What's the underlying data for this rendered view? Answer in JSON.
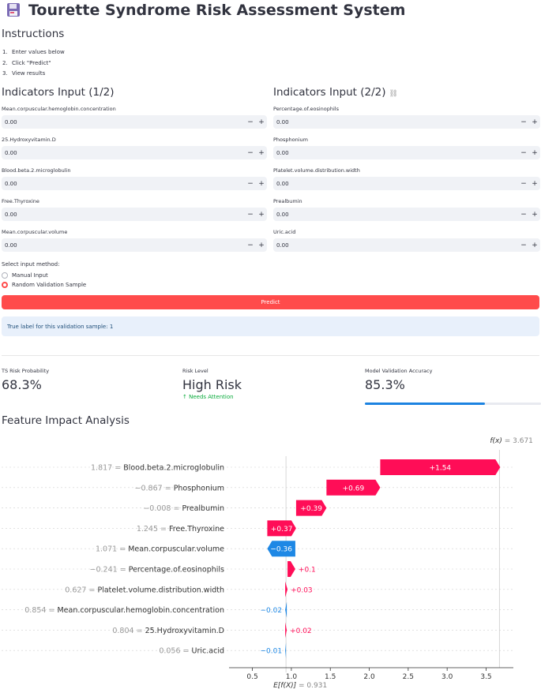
{
  "app": {
    "title": "Tourette Syndrome Risk Assessment System",
    "icon": "floppy-disk-icon"
  },
  "instructions": {
    "heading": "Instructions",
    "steps": [
      {
        "n": "1.",
        "text": "Enter values below"
      },
      {
        "n": "2.",
        "text": "Click \"Predict\""
      },
      {
        "n": "3.",
        "text": "View results"
      }
    ]
  },
  "panel1": {
    "heading": "Indicators Input (1/2)",
    "fields": [
      {
        "label": "Mean.corpuscular.hemoglobin.concentration",
        "value": "0.00"
      },
      {
        "label": "25.Hydroxyvitamin.D",
        "value": "0.00"
      },
      {
        "label": "Blood.beta.2.microglobulin",
        "value": "0.00"
      },
      {
        "label": "Free.Thyroxine",
        "value": "0.00"
      },
      {
        "label": "Mean.corpuscular.volume",
        "value": "0.00"
      }
    ]
  },
  "panel2": {
    "heading": "Indicators Input (2/2)",
    "fields": [
      {
        "label": "Percentage.of.eosinophils",
        "value": "0.00"
      },
      {
        "label": "Phosphonium",
        "value": "0.00"
      },
      {
        "label": "Platelet.volume.distribution.width",
        "value": "0.00"
      },
      {
        "label": "Prealbumin",
        "value": "0.00"
      },
      {
        "label": "Uric.acid",
        "value": "0.00"
      }
    ]
  },
  "stepper": {
    "minus": "−",
    "plus": "+"
  },
  "method": {
    "label": "Select input method:",
    "options": [
      {
        "label": "Manual Input",
        "selected": false
      },
      {
        "label": "Random Validation Sample",
        "selected": true
      }
    ]
  },
  "predict_button": "Predict",
  "info_text": "True label for this validation sample: 1",
  "metrics": {
    "prob_label": "TS Risk Probability",
    "prob_value": "68.3%",
    "level_label": "Risk Level",
    "level_value": "High Risk",
    "level_delta": "↑ Needs Attention",
    "acc_label": "Model Validation Accuracy",
    "acc_value": "85.3%",
    "acc_progress": 0.68
  },
  "impact_heading": "Feature Impact Analysis",
  "colors": {
    "positive": "#ff0d57",
    "negative": "#1e88e5",
    "accent": "#ff4b4b",
    "info_bg": "#e8f0fb"
  },
  "chart_data": {
    "type": "waterfall",
    "base_label": "E[f(X)]",
    "base_value": 0.931,
    "output_label": "f(x)",
    "output_value": 3.671,
    "xlim": [
      0.2,
      3.85
    ],
    "xticks": [
      0.5,
      1.0,
      1.5,
      2.0,
      2.5,
      3.0,
      3.5
    ],
    "xtick_labels": [
      "0.5",
      "1.0",
      "1.5",
      "2.0",
      "2.5",
      "3.0",
      "3.5"
    ],
    "features": [
      {
        "name": "Blood.beta.2.microglobulin",
        "value": "1.817",
        "shap": 1.54,
        "label": "+1.54"
      },
      {
        "name": "Phosphonium",
        "value": "−0.867",
        "shap": 0.69,
        "label": "+0.69"
      },
      {
        "name": "Prealbumin",
        "value": "−0.008",
        "shap": 0.39,
        "label": "+0.39"
      },
      {
        "name": "Free.Thyroxine",
        "value": "1.245",
        "shap": 0.37,
        "label": "+0.37"
      },
      {
        "name": "Mean.corpuscular.volume",
        "value": "1.071",
        "shap": -0.36,
        "label": "−0.36"
      },
      {
        "name": "Percentage.of.eosinophils",
        "value": "−0.241",
        "shap": 0.1,
        "label": "+0.1"
      },
      {
        "name": "Platelet.volume.distribution.width",
        "value": "0.627",
        "shap": 0.03,
        "label": "+0.03"
      },
      {
        "name": "Mean.corpuscular.hemoglobin.concentration",
        "value": "0.854",
        "shap": -0.02,
        "label": "−0.02"
      },
      {
        "name": "25.Hydroxyvitamin.D",
        "value": "0.804",
        "shap": 0.02,
        "label": "+0.02"
      },
      {
        "name": "Uric.acid",
        "value": "0.056",
        "shap": -0.01,
        "label": "−0.01"
      }
    ]
  }
}
